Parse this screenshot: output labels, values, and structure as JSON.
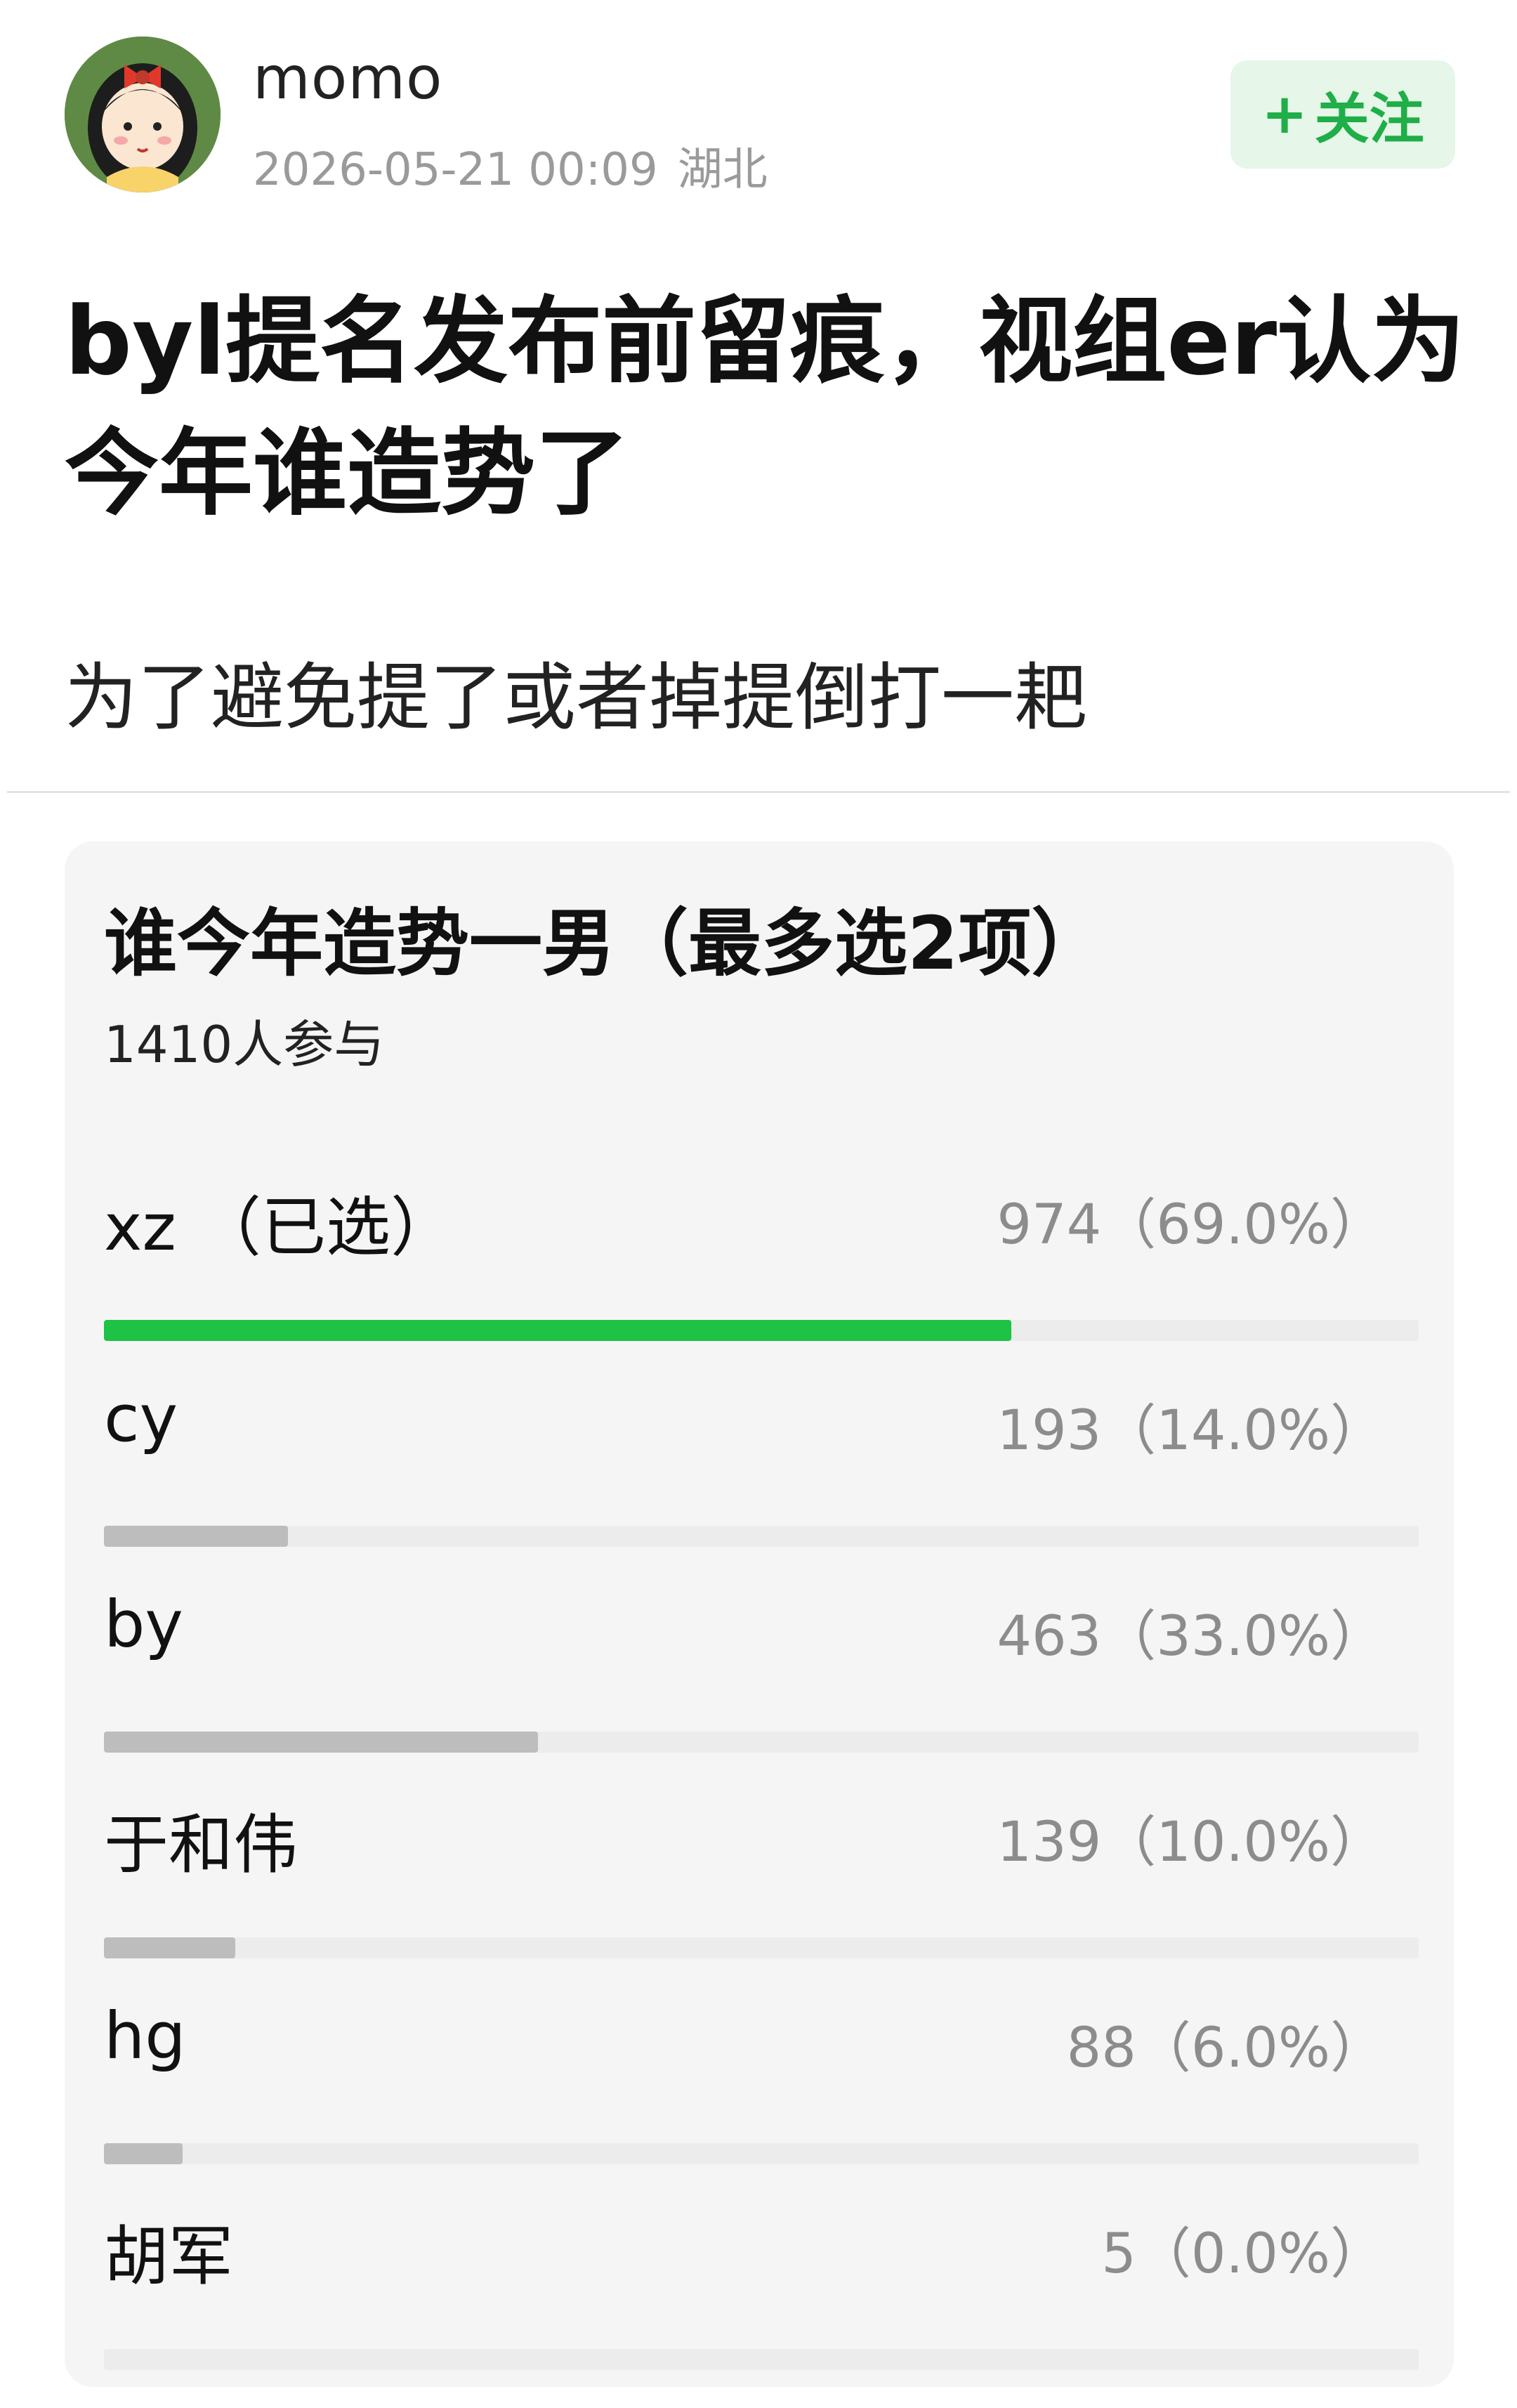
{
  "post": {
    "username": "momo",
    "date": "2026-05-21 00:09",
    "location": "湖北",
    "follow_plus": "+",
    "follow_label": "关注",
    "title": "byl提名发布前留痕，视组er认为今年谁造势了",
    "body": "为了避免提了或者掉提倒打一耙"
  },
  "poll": {
    "title": "谁今年造势一男（最多选2项）",
    "participants": "1410人参与",
    "options": [
      {
        "label": "xz （已选）",
        "value": "974（69.0%）",
        "percent": 69.0,
        "selected": true
      },
      {
        "label": "cy",
        "value": "193（14.0%）",
        "percent": 14.0,
        "selected": false
      },
      {
        "label": "by",
        "value": "463（33.0%）",
        "percent": 33.0,
        "selected": false
      },
      {
        "label": "于和伟",
        "value": "139（10.0%）",
        "percent": 10.0,
        "selected": false
      },
      {
        "label": "hg",
        "value": "88（6.0%）",
        "percent": 6.0,
        "selected": false
      },
      {
        "label": "胡军",
        "value": "5（0.0%）",
        "percent": 0.0,
        "selected": false
      }
    ]
  },
  "colors": {
    "accent_green": "#1ec244",
    "follow_bg": "#e6f6e9",
    "bar_gray": "#bdbdbd"
  },
  "icons": {
    "avatar": "cartoon-girl-avatar"
  }
}
